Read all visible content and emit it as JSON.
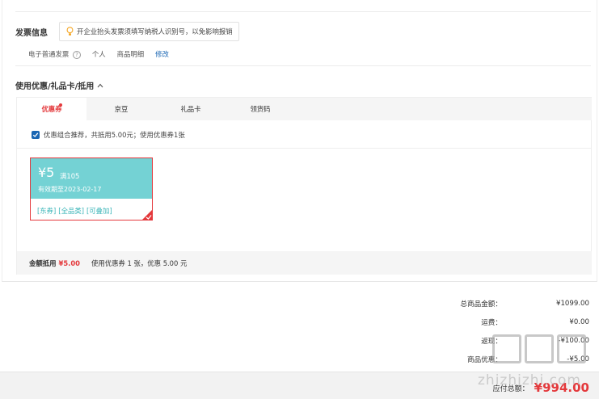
{
  "invoice": {
    "title": "发票信息",
    "tip": "开企业抬头发票须填写纳税人识别号，以免影响报销",
    "type": "电子普通发票",
    "help_glyph": "?",
    "header": "个人",
    "content": "商品明细",
    "modify": "修改"
  },
  "coupons": {
    "title": "使用优惠/礼品卡/抵用",
    "tabs": [
      {
        "label": "优惠券",
        "active": true
      },
      {
        "label": "京豆",
        "active": false
      },
      {
        "label": "礼品卡",
        "active": false
      },
      {
        "label": "领货码",
        "active": false
      }
    ],
    "combo_text": "优惠组合推荐，共抵用5.00元；使用优惠券1张",
    "combo_checked": true,
    "card": {
      "amount": "¥5",
      "condition": "满105",
      "valid": "有效期至2023-02-17",
      "tags": [
        "[东券]",
        "[全品类]",
        "[可叠加]"
      ],
      "selected": true
    },
    "footer": {
      "label": "金额抵用",
      "amount": "¥5.00",
      "detail": "使用优惠券 1 张，优惠 5.00 元"
    }
  },
  "summary": {
    "rows": [
      {
        "label": "总商品金额：",
        "value": "¥1099.00"
      },
      {
        "label": "运费：",
        "value": "¥0.00"
      },
      {
        "label": "返现：",
        "value": "-¥100.00"
      },
      {
        "label": "商品优惠：",
        "value": "-¥5.00"
      }
    ],
    "pay_label": "应付总额：",
    "pay_amount": "¥994.00"
  },
  "watermark": {
    "text": "zhizhizhi.com"
  },
  "colors": {
    "accent": "#e4393c",
    "link": "#1a66b3",
    "coupon_bg": "#74d2d4",
    "tag": "#3ab5b8"
  }
}
